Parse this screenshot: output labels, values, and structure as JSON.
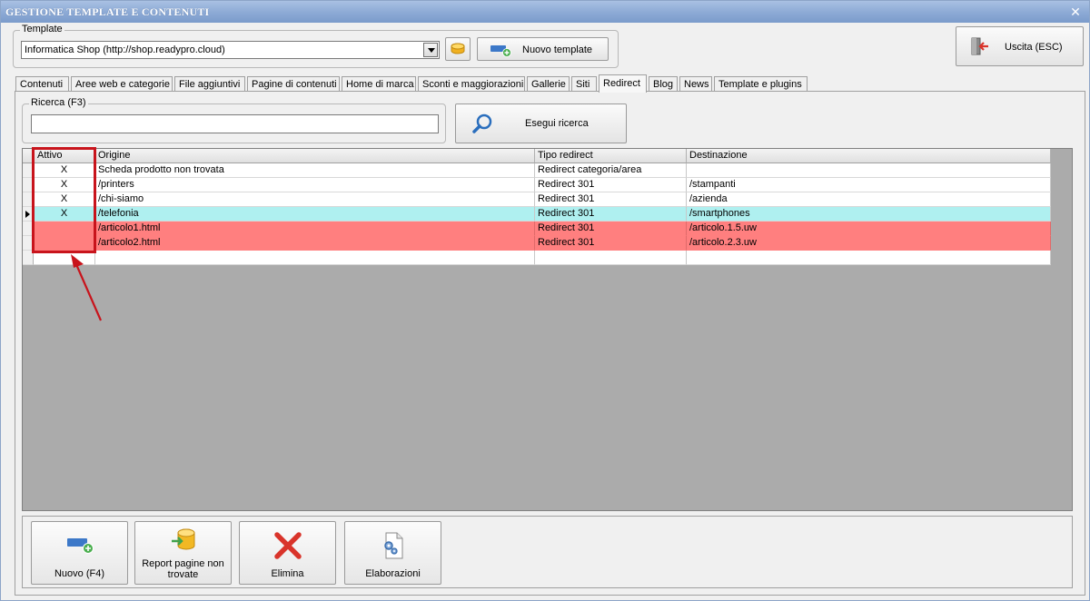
{
  "window": {
    "title": "GESTIONE TEMPLATE E CONTENUTI",
    "close_glyph": "✕"
  },
  "template_group": {
    "label": "Template",
    "selected": "Informatica Shop (http://shop.readypro.cloud)",
    "new_template_label": "Nuovo template"
  },
  "exit_button": {
    "label": "Uscita (ESC)"
  },
  "tabs": [
    {
      "label": "Contenuti"
    },
    {
      "label": "Aree web e categorie"
    },
    {
      "label": "File aggiuntivi"
    },
    {
      "label": "Pagine di contenuti"
    },
    {
      "label": "Home di marca"
    },
    {
      "label": "Sconti e maggiorazioni"
    },
    {
      "label": "Gallerie"
    },
    {
      "label": "Siti"
    },
    {
      "label": "Redirect"
    },
    {
      "label": "Blog"
    },
    {
      "label": "News"
    },
    {
      "label": "Template e plugins"
    }
  ],
  "search": {
    "label": "Ricerca (F3)",
    "value": "",
    "button_label": "Esegui ricerca"
  },
  "grid": {
    "columns": [
      "Attivo",
      "Origine",
      "Tipo redirect",
      "Destinazione"
    ],
    "rows": [
      {
        "attivo": "X",
        "origine": "Scheda prodotto non trovata",
        "tipo": "Redirect categoria/area",
        "destinazione": ""
      },
      {
        "attivo": "X",
        "origine": "/printers",
        "tipo": "Redirect 301",
        "destinazione": "/stampanti"
      },
      {
        "attivo": "X",
        "origine": "/chi-siamo",
        "tipo": "Redirect 301",
        "destinazione": "/azienda"
      },
      {
        "attivo": "X",
        "origine": "/telefonia",
        "tipo": "Redirect 301",
        "destinazione": "/smartphones"
      },
      {
        "attivo": "",
        "origine": "/articolo1.html",
        "tipo": "Redirect 301",
        "destinazione": "/articolo.1.5.uw"
      },
      {
        "attivo": "",
        "origine": "/articolo2.html",
        "tipo": "Redirect 301",
        "destinazione": "/articolo.2.3.uw"
      },
      {
        "attivo": "",
        "origine": "",
        "tipo": "",
        "destinazione": ""
      }
    ]
  },
  "toolbar": {
    "new_label": "Nuovo (F4)",
    "report_label_line1": "Report pagine non",
    "report_label_line2": "trovate",
    "delete_label": "Elimina",
    "processing_label": "Elaborazioni"
  },
  "colors": {
    "active_row": "#aff0f0",
    "inactive_row": "#ff7f7f",
    "highlight": "#c8141c",
    "title_bar": "#8eabd6"
  }
}
